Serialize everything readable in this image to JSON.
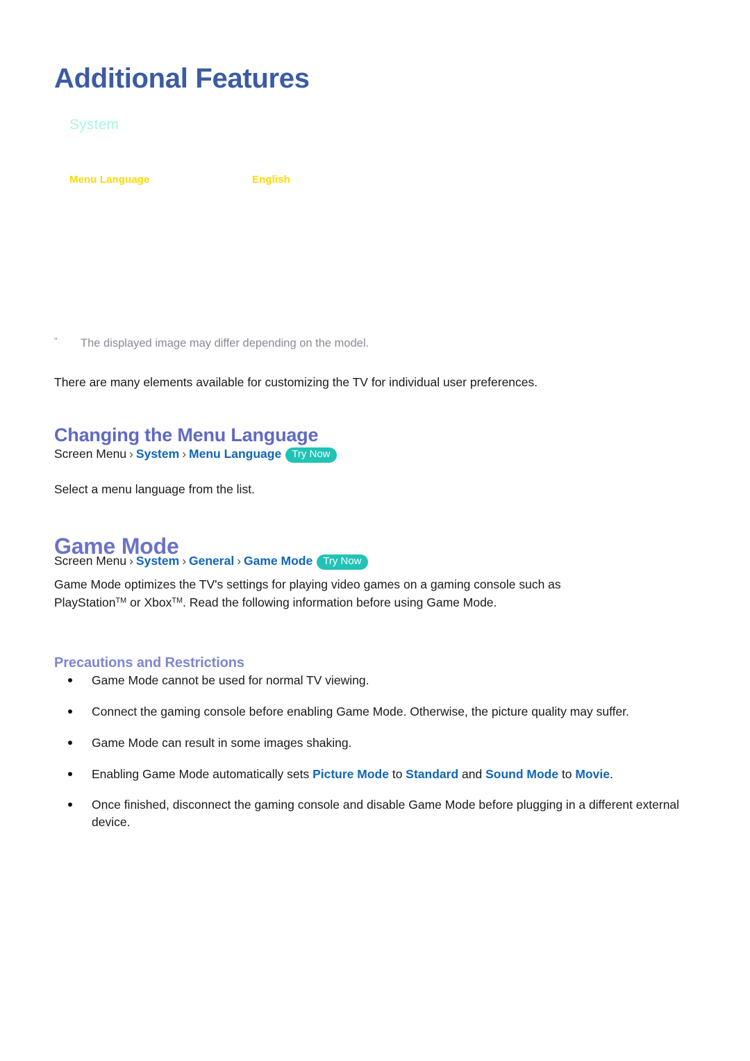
{
  "document": {
    "title": "Additional Features"
  },
  "tv_menu_sim": {
    "menu_title": "System",
    "rows": [
      {
        "label": "Menu Language",
        "value": "English"
      }
    ],
    "colors": {
      "menu_title": "#a9f6e1",
      "row_text": "#ffd900"
    }
  },
  "note": {
    "mark": "\"",
    "text": "The displayed image may differ depending on the model."
  },
  "intro": {
    "text": "There are many elements available for customizing the TV for individual user preferences."
  },
  "sections": {
    "menu_language": {
      "heading": "Changing the Menu Language",
      "path": {
        "root": "Screen Menu",
        "separator": "›",
        "links": [
          "System",
          "Menu Language"
        ],
        "badge": "Try Now"
      },
      "description": "Select a menu language from the list."
    },
    "game_mode": {
      "heading": "Game Mode",
      "path": {
        "root": "Screen Menu",
        "separator": "›",
        "links": [
          "System",
          "General",
          "Game Mode"
        ],
        "badge": "Try Now"
      },
      "description_line1": "Game Mode optimizes the TV's settings for playing video games on a gaming console such as",
      "description_line2_pre": "PlayStation",
      "description_line2_tm1": "TM",
      "description_line2_mid": " or Xbox",
      "description_line2_tm2": "TM",
      "description_line2_post": ". Read the following information before using Game Mode.",
      "subheading": "Precautions and Restrictions",
      "bullets": [
        {
          "id": "bullet-normal-tv",
          "parts": [
            {
              "type": "text",
              "value": "Game Mode cannot be used for normal TV viewing."
            }
          ]
        },
        {
          "id": "bullet-connect-console",
          "parts": [
            {
              "type": "text",
              "value": "Connect the gaming console before enabling Game Mode. Otherwise, the picture quality may suffer."
            }
          ]
        },
        {
          "id": "bullet-images-shaking",
          "parts": [
            {
              "type": "text",
              "value": "Game Mode can result in some images shaking."
            }
          ]
        },
        {
          "id": "bullet-auto-sets",
          "parts": [
            {
              "type": "text",
              "value": "Enabling Game Mode automatically sets "
            },
            {
              "type": "term",
              "value": "Picture Mode"
            },
            {
              "type": "text",
              "value": " to "
            },
            {
              "type": "term",
              "value": "Standard"
            },
            {
              "type": "text",
              "value": " and "
            },
            {
              "type": "term",
              "value": "Sound Mode"
            },
            {
              "type": "text",
              "value": " to "
            },
            {
              "type": "term",
              "value": "Movie"
            },
            {
              "type": "text",
              "value": "."
            }
          ]
        },
        {
          "id": "bullet-once-finished",
          "parts": [
            {
              "type": "text",
              "value": "Once finished, disconnect the gaming console and disable Game Mode before plugging in a different external device."
            }
          ]
        }
      ]
    }
  },
  "colors": {
    "page_title": "#3b5ba3",
    "heading_purple": "#6b72c9",
    "subheading_purple": "#7f86cc",
    "link_blue": "#1166b8",
    "badge_teal": "#21c3b6",
    "note_gray": "#8a8a94"
  }
}
